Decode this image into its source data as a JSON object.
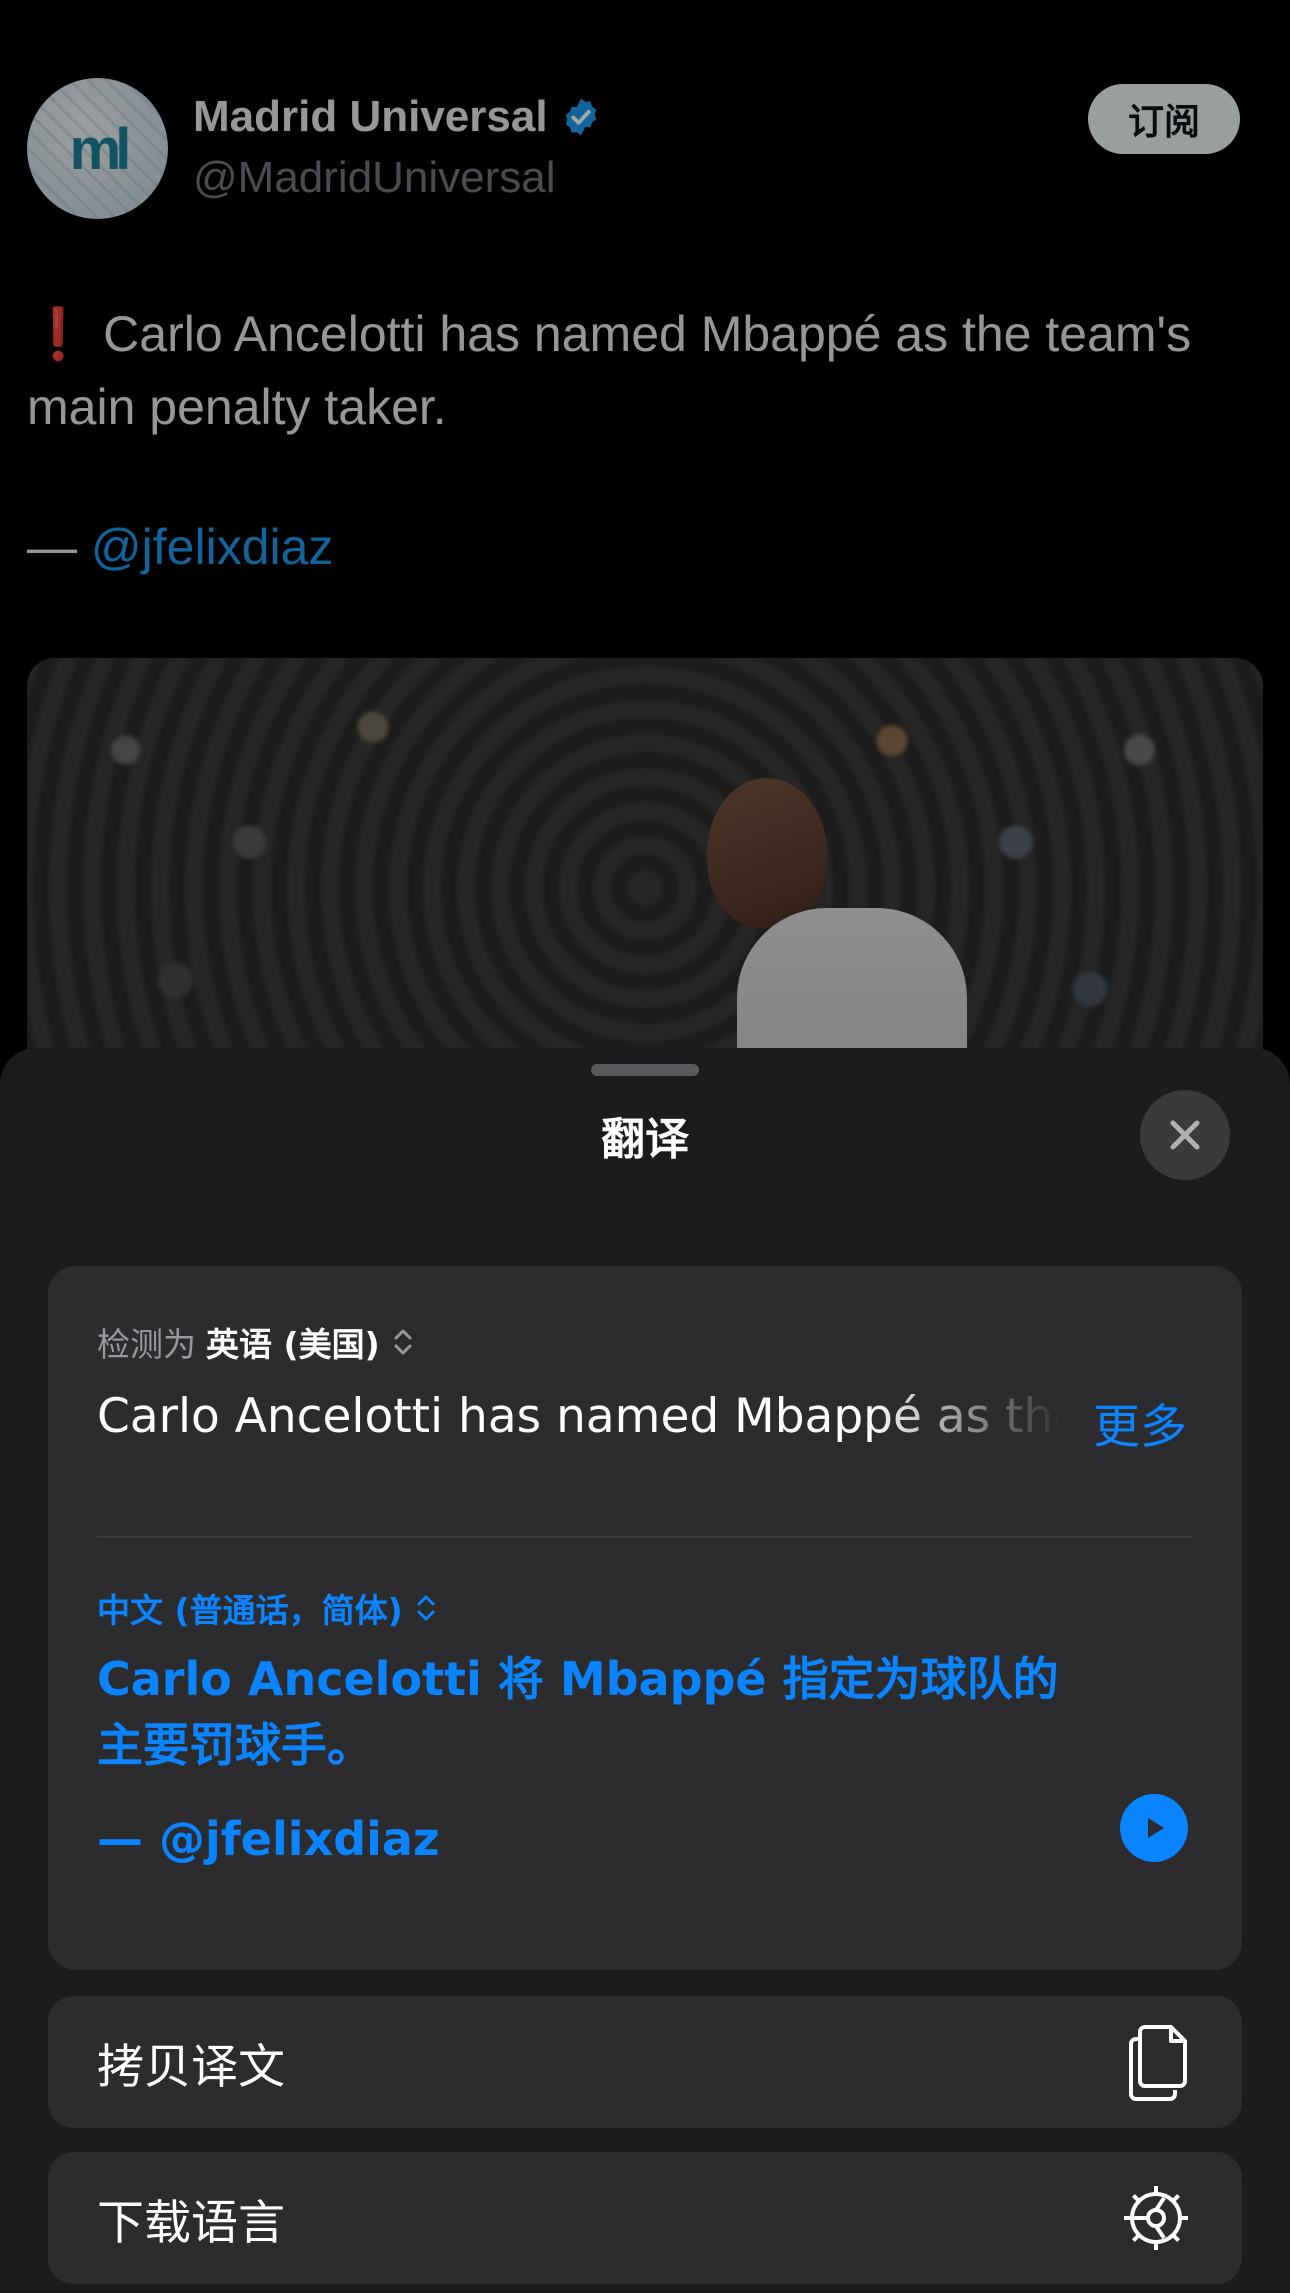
{
  "tweet": {
    "avatar_text": "ml",
    "display_name": "Madrid Universal",
    "handle": "@MadridUniversal",
    "subscribe_label": "订阅",
    "text_line": "❗ Carlo Ancelotti has named Mbappé as the team's main penalty taker.",
    "credit_dash": "— ",
    "credit_mention": "@jfelixdiaz"
  },
  "sheet": {
    "title": "翻译",
    "detected_prefix": "检测为",
    "detected_language": "英语 (美国)",
    "source_text": "Carlo Ancelotti has named Mbappé as the team's main penalty taker.",
    "more_label": "更多",
    "target_language": "中文 (普通话，简体)",
    "translation": "Carlo Ancelotti 将 Mbappé 指定为球队的主要罚球手。",
    "translation_credit": "— @jfelixdiaz",
    "actions": [
      {
        "label": "拷贝译文",
        "icon": "copy-icon"
      },
      {
        "label": "下载语言",
        "icon": "gear-icon"
      }
    ]
  },
  "colors": {
    "accent": "#0a84ff",
    "twitter_blue": "#1d9bf0",
    "sheet_bg": "#1c1c1e",
    "card_bg": "#2c2c2e"
  }
}
